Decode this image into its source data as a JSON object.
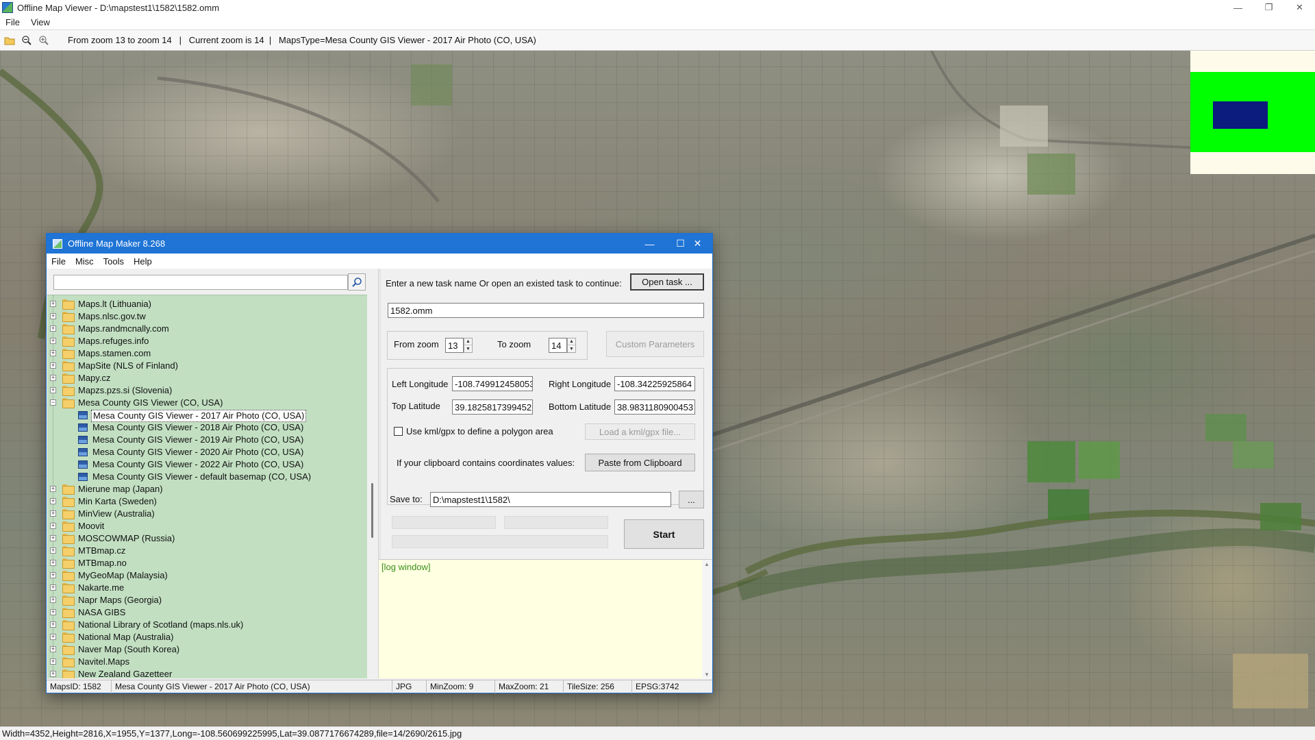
{
  "viewer": {
    "title": "Offline Map Viewer - D:\\mapstest1\\1582\\1582.omm",
    "menu": [
      "File",
      "View"
    ],
    "toolbar_status": "From zoom 13 to zoom 14   |   Current zoom is 14  |   MapsType=Mesa County GIS Viewer - 2017 Air Photo (CO, USA)",
    "bottom_status": "Width=4352,Height=2816,X=1955,Y=1377,Long=-108.560699225995,Lat=39.0877176674289,file=14/2690/2615.jpg",
    "icons": [
      "open-folder-icon",
      "zoom-out-icon",
      "zoom-in-icon"
    ]
  },
  "dialog": {
    "title": "Offline Map Maker 8.268",
    "menu": [
      "File",
      "Misc",
      "Tools",
      "Help"
    ],
    "search": {
      "value": "",
      "placeholder": ""
    },
    "tree": [
      {
        "label": "Maps.lt (Lithuania)",
        "level": 0,
        "expanded": false
      },
      {
        "label": "Maps.nlsc.gov.tw",
        "level": 0,
        "expanded": false
      },
      {
        "label": "Maps.randmcnally.com",
        "level": 0,
        "expanded": false
      },
      {
        "label": "Maps.refuges.info",
        "level": 0,
        "expanded": false
      },
      {
        "label": "Maps.stamen.com",
        "level": 0,
        "expanded": false
      },
      {
        "label": "MapSite (NLS of Finland)",
        "level": 0,
        "expanded": false
      },
      {
        "label": "Mapy.cz",
        "level": 0,
        "expanded": false
      },
      {
        "label": "Mapzs.pzs.si (Slovenia)",
        "level": 0,
        "expanded": false
      },
      {
        "label": "Mesa County GIS Viewer (CO, USA)",
        "level": 0,
        "expanded": true
      },
      {
        "label": "Mesa County GIS Viewer - 2017 Air Photo (CO, USA)",
        "level": 1,
        "selected": true
      },
      {
        "label": "Mesa County GIS Viewer - 2018 Air Photo (CO, USA)",
        "level": 1
      },
      {
        "label": "Mesa County GIS Viewer - 2019 Air Photo (CO, USA)",
        "level": 1
      },
      {
        "label": "Mesa County GIS Viewer - 2020 Air Photo (CO, USA)",
        "level": 1
      },
      {
        "label": "Mesa County GIS Viewer - 2022 Air Photo (CO, USA)",
        "level": 1
      },
      {
        "label": "Mesa County GIS Viewer - default basemap (CO, USA)",
        "level": 1
      },
      {
        "label": "Mierune map (Japan)",
        "level": 0,
        "expanded": false
      },
      {
        "label": "Min Karta (Sweden)",
        "level": 0,
        "expanded": false
      },
      {
        "label": "MinView (Australia)",
        "level": 0,
        "expanded": false
      },
      {
        "label": "Moovit",
        "level": 0,
        "expanded": false
      },
      {
        "label": "MOSCOWMAP (Russia)",
        "level": 0,
        "expanded": false
      },
      {
        "label": "MTBmap.cz",
        "level": 0,
        "expanded": false
      },
      {
        "label": "MTBmap.no",
        "level": 0,
        "expanded": false
      },
      {
        "label": "MyGeoMap (Malaysia)",
        "level": 0,
        "expanded": false
      },
      {
        "label": "Nakarte.me",
        "level": 0,
        "expanded": false
      },
      {
        "label": "Napr Maps (Georgia)",
        "level": 0,
        "expanded": false
      },
      {
        "label": "NASA GIBS",
        "level": 0,
        "expanded": false
      },
      {
        "label": "National Library of Scotland (maps.nls.uk)",
        "level": 0,
        "expanded": false
      },
      {
        "label": "National Map (Australia)",
        "level": 0,
        "expanded": false
      },
      {
        "label": "Naver Map (South Korea)",
        "level": 0,
        "expanded": false
      },
      {
        "label": "Navitel.Maps",
        "level": 0,
        "expanded": false
      },
      {
        "label": "New Zealand Gazetteer",
        "level": 0,
        "expanded": false
      }
    ],
    "form": {
      "task_prompt": "Enter a new task name Or open an existed task to continue:",
      "open_task_label": "Open task ...",
      "task_name": "1582.omm",
      "from_zoom_label": "From zoom",
      "from_zoom": "13",
      "to_zoom_label": "To zoom",
      "to_zoom": "14",
      "custom_params_label": "Custom Parameters",
      "left_lon_label": "Left Longitude",
      "left_lon": "-108.749912458053",
      "right_lon_label": "Right Longitude",
      "right_lon": "-108.34225925864",
      "top_lat_label": "Top Latitude",
      "top_lat": "39.1825817399452",
      "bottom_lat_label": "Bottom Latitude",
      "bottom_lat": "38.9831180900453",
      "kml_checkbox_label": "Use kml/gpx to define a polygon area",
      "kml_checked": false,
      "load_kml_label": "Load a kml/gpx file...",
      "clipboard_prompt": "If your clipboard contains coordinates values:",
      "paste_label": "Paste from Clipboard",
      "save_to_label": "Save to:",
      "save_to": "D:\\mapstest1\\1582\\",
      "browse_label": "...",
      "start_label": "Start"
    },
    "log": "[log window]",
    "status": {
      "maps_id": "MapsID: 1582",
      "maps_name": "Mesa County GIS Viewer - 2017 Air Photo (CO, USA)",
      "format": "JPG",
      "min_zoom": "MinZoom: 9",
      "max_zoom": "MaxZoom: 21",
      "tile_size": "TileSize: 256",
      "epsg": "EPSG:3742"
    }
  },
  "colors": {
    "dialog_title": "#1f74d6",
    "tree_bg": "#c2dfc2",
    "log_bg": "#ffffe1",
    "overview_green": "#00ff00",
    "overview_viewport": "#0b1b7e"
  }
}
